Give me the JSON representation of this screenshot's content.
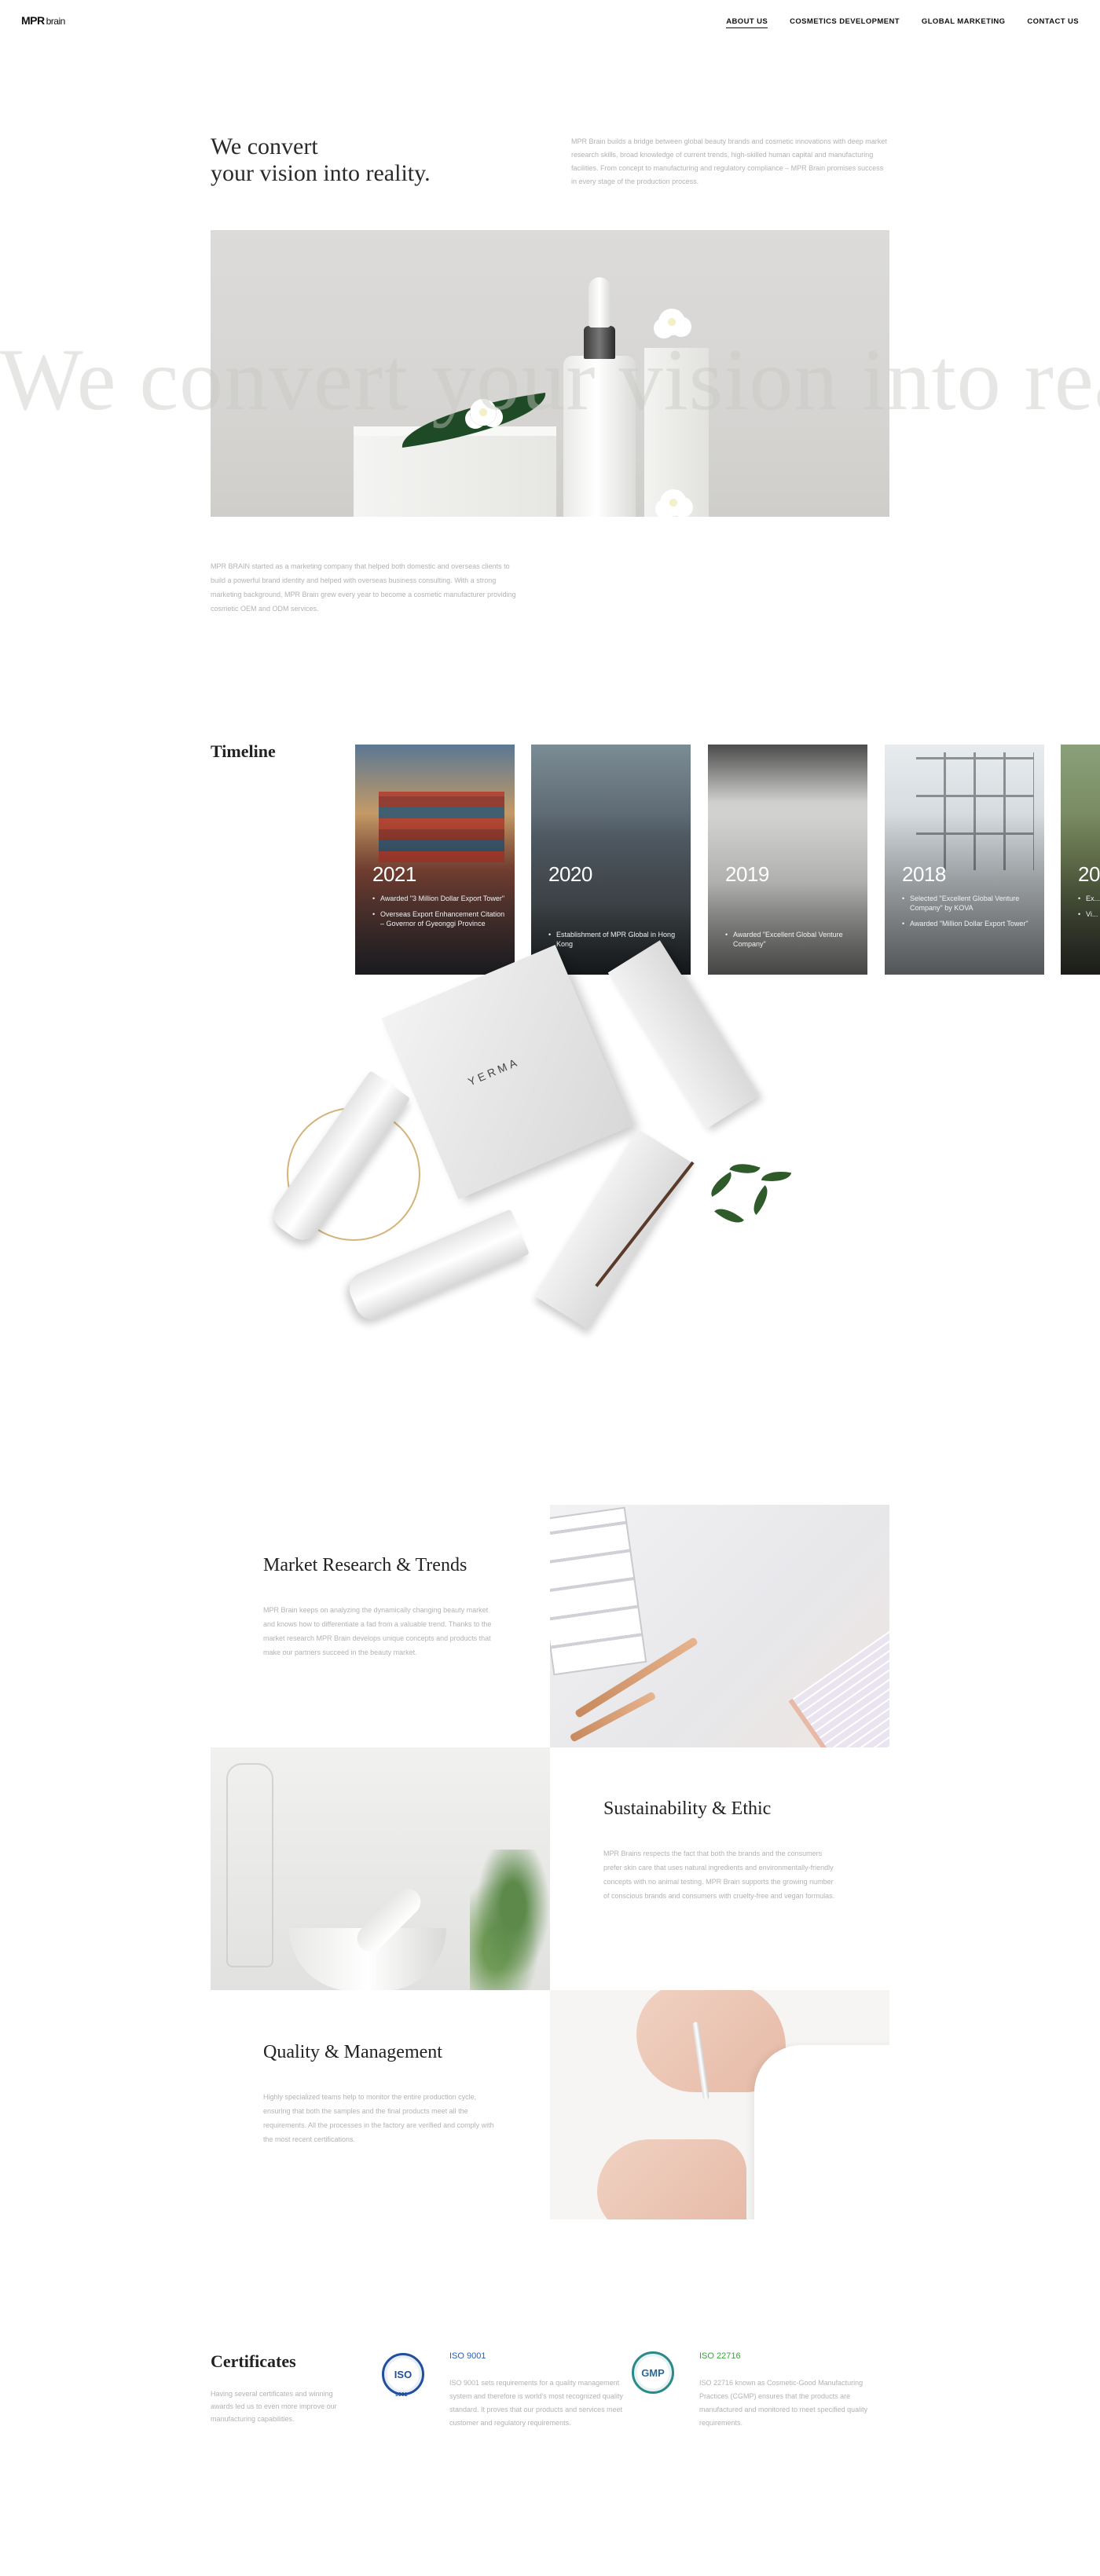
{
  "header": {
    "logo": "MPR",
    "logo_suffix": "brain",
    "nav": [
      "ABOUT US",
      "COSMETICS DEVELOPMENT",
      "GLOBAL MARKETING",
      "CONTACT US"
    ]
  },
  "hero": {
    "title_line1": "We convert",
    "title_line2": "your vision into reality.",
    "description": "MPR Brain builds a bridge between global beauty brands and cosmetic innovations with deep market research skills, broad knowledge of current trends, high-skilled human capital and manufacturing facilities. From concept to manufacturing and regulatory compliance – MPR Brain promises success in every stage of the production process.",
    "ghost_text": "We convert your vision into reality."
  },
  "about": {
    "text": "MPR BRAIN started as a marketing company that helped both domestic and overseas clients to build a powerful brand identity and helped with overseas business consulting. With a strong marketing background, MPR Brain grew every year to become a cosmetic manufacturer providing cosmetic OEM and ODM services."
  },
  "timeline": {
    "title": "Timeline",
    "cards": [
      {
        "year": "2021",
        "items": [
          "Awarded \"3 Million Dollar Export Tower\"",
          "Overseas Export Enhancement Citation – Governor of Gyeonggi Province"
        ]
      },
      {
        "year": "2020",
        "items": [
          "Establishment of MPR Global in Hong Kong"
        ]
      },
      {
        "year": "2019",
        "items": [
          "Awarded \"Excellent Global Venture Company\""
        ]
      },
      {
        "year": "2018",
        "items": [
          "Selected \"Excellent Global Venture Company\" by KOVA",
          "Awarded \"Million Dollar Export Tower\""
        ]
      },
      {
        "year": "20",
        "items": [
          "Ex...",
          "Vi..."
        ]
      }
    ]
  },
  "products": {
    "brand": "YERMA"
  },
  "features": [
    {
      "title": "Market Research & Trends",
      "description": "MPR Brain keeps on analyzing the dynamically changing beauty market and knows how to differentiate a fad from a valuable trend. Thanks to the market research MPR Brain develops unique concepts and products that make our partners succeed in the beauty market."
    },
    {
      "title": "Sustainability & Ethic",
      "description": "MPR Brains respects the fact that both the brands and the consumers prefer skin care that uses natural ingredients and environmentally-friendly concepts with no animal testing. MPR Brain supports the growing number of conscious brands and consumers with cruelty-free and vegan formulas."
    },
    {
      "title": "Quality & Management",
      "description": "Highly specialized teams help to monitor the entire production cycle, ensuring that both the samples and the final products meet all the requirements. All the processes in the factory are verified and comply with the most recent certifications."
    }
  ],
  "certificates": {
    "title": "Certificates",
    "description": "Having several certificates and winning awards led us to even more improve our manufacturing capabilities.",
    "items": [
      {
        "logo_text": "ISO",
        "logo_sub": "9001",
        "name": "ISO 9001",
        "color": "#1f5fbf",
        "text": "ISO 9001 sets requirements for a quality management system and therefore is world's most recognized quality standard. It proves that our products and services meet customer and regulatory requirements."
      },
      {
        "logo_text": "GMP",
        "name": "ISO 22716",
        "color": "#3aa53a",
        "text": "ISO 22716 known as Cosmetic-Good Manufacturing Practices (CGMP) ensures that the products are manufactured and monitored to meet specified quality requirements."
      }
    ]
  }
}
